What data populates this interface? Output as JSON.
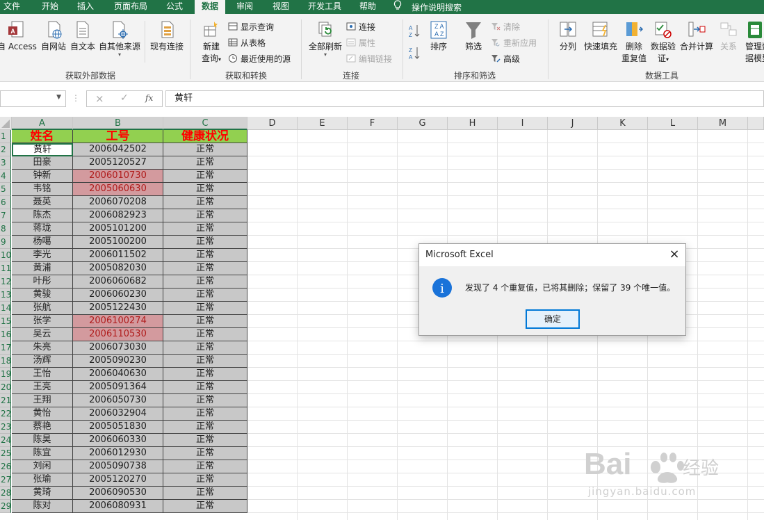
{
  "tabs": [
    "文件",
    "开始",
    "插入",
    "页面布局",
    "公式",
    "数据",
    "审阅",
    "视图",
    "开发工具",
    "帮助",
    "操作说明搜索"
  ],
  "active_tab": "数据",
  "ribbon": {
    "get_external": {
      "buttons": [
        "自 Access",
        "自网站",
        "自文本",
        "自其他来源",
        "现有连接"
      ],
      "label": "获取外部数据"
    },
    "transform": {
      "new_query_line1": "新建",
      "new_query_line2": "查询",
      "show_queries": "显示查询",
      "from_table": "从表格",
      "recent_sources": "最近使用的源",
      "label": "获取和转换"
    },
    "connections": {
      "refresh_all": "全部刷新",
      "connections": "连接",
      "properties": "属性",
      "edit_links": "编辑链接",
      "label": "连接"
    },
    "sort_filter": {
      "sort": "排序",
      "filter": "筛选",
      "clear": "清除",
      "reapply": "重新应用",
      "advanced": "高级",
      "label": "排序和筛选"
    },
    "tools": {
      "text_to_columns": "分列",
      "flash_fill": "快速填充",
      "remove_dup_line1": "删除",
      "remove_dup_line2": "重复值",
      "validation_line1": "数据验",
      "validation_line2": "证",
      "consolidate": "合并计算",
      "relationships": "关系",
      "manage_model_line1": "管理数",
      "manage_model_line2": "据模型",
      "label": "数据工具"
    }
  },
  "formula_bar": {
    "cancel_icon": "×",
    "enter_icon": "✓",
    "fx": "fx",
    "value": "黄轩"
  },
  "columns": [
    "A",
    "B",
    "C",
    "D",
    "E",
    "F",
    "G",
    "H",
    "I",
    "J",
    "K",
    "L",
    "M"
  ],
  "row_numbers": [
    "1",
    "2",
    "3",
    "4",
    "5",
    "6",
    "7",
    "8",
    "9",
    "10",
    "11",
    "12",
    "13",
    "14",
    "15",
    "16",
    "17",
    "18",
    "19",
    "20",
    "21",
    "22",
    "23",
    "24",
    "25",
    "26",
    "27",
    "28",
    "29"
  ],
  "table": {
    "headers": [
      "姓名",
      "工号",
      "健康状况"
    ],
    "rows": [
      [
        "黄轩",
        "2006042502",
        "正常"
      ],
      [
        "田豪",
        "2005120527",
        "正常"
      ],
      [
        "钟新",
        "2006010730",
        "正常"
      ],
      [
        "韦铭",
        "2005060630",
        "正常"
      ],
      [
        "聂英",
        "2006070208",
        "正常"
      ],
      [
        "陈杰",
        "2006082923",
        "正常"
      ],
      [
        "蒋珑",
        "2005101200",
        "正常"
      ],
      [
        "杨噶",
        "2005100200",
        "正常"
      ],
      [
        "李光",
        "2006011502",
        "正常"
      ],
      [
        "黄浦",
        "2005082030",
        "正常"
      ],
      [
        "叶彤",
        "2006060682",
        "正常"
      ],
      [
        "黄骏",
        "2006060230",
        "正常"
      ],
      [
        "张航",
        "2005122430",
        "正常"
      ],
      [
        "张学",
        "2006100274",
        "正常"
      ],
      [
        "吴云",
        "2006110530",
        "正常"
      ],
      [
        "朱亮",
        "2006073030",
        "正常"
      ],
      [
        "汤辉",
        "2005090230",
        "正常"
      ],
      [
        "王怡",
        "2006040630",
        "正常"
      ],
      [
        "王亮",
        "2005091364",
        "正常"
      ],
      [
        "王翔",
        "2006050730",
        "正常"
      ],
      [
        "黄怡",
        "2006032904",
        "正常"
      ],
      [
        "蔡艳",
        "2005051830",
        "正常"
      ],
      [
        "陈昊",
        "2006060330",
        "正常"
      ],
      [
        "陈宜",
        "2006012930",
        "正常"
      ],
      [
        "刘闲",
        "2005090738",
        "正常"
      ],
      [
        "张瑜",
        "2005120270",
        "正常"
      ],
      [
        "黄琦",
        "2006090530",
        "正常"
      ],
      [
        "陈对",
        "2006080931",
        "正常"
      ]
    ],
    "highlighted_row_indexes": [
      2,
      3,
      13,
      14
    ]
  },
  "dialog": {
    "title": "Microsoft Excel",
    "close_icon": "×",
    "info_icon": "i",
    "message": "发现了 4 个重复值，已将其删除；保留了 39 个唯一值。",
    "ok_label": "确定"
  },
  "watermark": {
    "brand": "Bai",
    "brand_cn": "经验",
    "url": "jingyan.baidu.com"
  },
  "colors": {
    "excel_green": "#217346",
    "header_fill": "#92d050",
    "header_text": "#ff0000",
    "duplicate_fill": "#d39a9e",
    "data_fill": "#c8c8c8"
  }
}
